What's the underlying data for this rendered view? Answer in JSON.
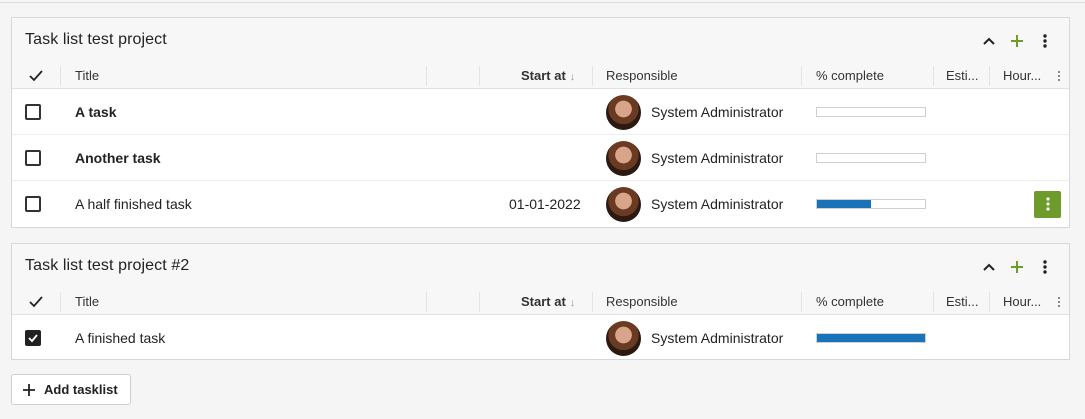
{
  "colors": {
    "accent_green": "#6e9c2c",
    "progress_blue": "#1a73b8"
  },
  "columns": {
    "title": "Title",
    "start_at": "Start at",
    "responsible": "Responsible",
    "percent_complete": "% complete",
    "estimate": "Esti...",
    "hours": "Hour..."
  },
  "tasklists": [
    {
      "title": "Task list test project",
      "tasks": [
        {
          "title": "A task",
          "bold": true,
          "start_at": "",
          "responsible": "System Administrator",
          "progress": 0,
          "checked": false
        },
        {
          "title": "Another task",
          "bold": true,
          "start_at": "",
          "responsible": "System Administrator",
          "progress": 0,
          "checked": false
        },
        {
          "title": "A half finished task",
          "bold": false,
          "start_at": "01-01-2022",
          "responsible": "System Administrator",
          "progress": 0.5,
          "checked": false
        }
      ]
    },
    {
      "title": "Task list test project #2",
      "tasks": [
        {
          "title": "A finished task",
          "bold": false,
          "start_at": "",
          "responsible": "System Administrator",
          "progress": 1.0,
          "checked": true
        }
      ]
    }
  ],
  "add_tasklist_label": "Add tasklist"
}
